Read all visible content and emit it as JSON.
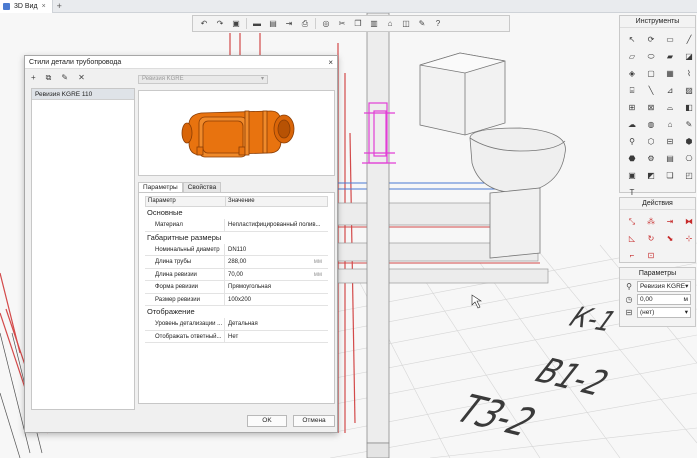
{
  "tab": {
    "title": "3D Вид",
    "close": "×",
    "add": "+"
  },
  "toolbar_icons": [
    "undo-icon",
    "redo-icon",
    "copy-view-icon",
    "save-icon",
    "save-as-icon",
    "export-icon",
    "print-icon",
    "render-icon",
    "cut-icon",
    "copy-icon",
    "paste-icon",
    "tag-icon",
    "layers-icon",
    "wrench-icon",
    "help-icon"
  ],
  "tools_panel": {
    "title": "Инструменты",
    "icons": [
      "pointer-icon",
      "rotate-icon",
      "rect-icon",
      "pipe-icon",
      "wall-icon",
      "slab-icon",
      "beam-icon",
      "column-icon",
      "part-icon",
      "fitting-icon",
      "duct-icon",
      "valve-icon",
      "stair-icon",
      "line-icon",
      "dim-icon",
      "hatch-icon",
      "text2-icon",
      "mep-icon",
      "fixture-icon",
      "equip-icon",
      "cloud-icon",
      "ring-icon",
      "house-icon",
      "pen-icon",
      "pin-icon",
      "shape-icon",
      "grid-icon",
      "cube-icon",
      "nut-icon",
      "gear-icon",
      "sheet-icon",
      "hex-icon",
      "box-icon",
      "wrap-icon",
      "copy2-icon",
      "layers2-icon",
      "text-icon"
    ]
  },
  "actions_panel": {
    "title": "Действия",
    "icons": [
      "move-icon",
      "array-icon",
      "align-icon",
      "mirror-icon",
      "offset-icon",
      "rotate2-icon",
      "stretch-icon",
      "split-icon",
      "trim-icon",
      "insert-icon"
    ]
  },
  "params_panel": {
    "title": "Параметры",
    "style_value": "Ревизия KGRE",
    "elevation_value": "0,00",
    "elevation_unit": "м",
    "level_value": "(нет)"
  },
  "dialog": {
    "title": "Стили детали трубопровода",
    "close": "×",
    "tool_glyphs": [
      "+",
      "⧉",
      "✎",
      "✕"
    ],
    "list_items": [
      "Ревизия KGRE 110"
    ],
    "preset_value": "Ревизия KGRE",
    "tabs": [
      "Параметры",
      "Свойства"
    ],
    "table_header": {
      "param": "Параметр",
      "value": "Значение"
    },
    "groups": [
      {
        "name": "Основные",
        "rows": [
          {
            "key": "Материал",
            "value": "Непластифицированный полив...",
            "unit": ""
          }
        ]
      },
      {
        "name": "Габаритные размеры",
        "rows": [
          {
            "key": "Номинальный диаметр",
            "value": "DN110",
            "unit": ""
          },
          {
            "key": "Длина трубы",
            "value": "288,00",
            "unit": "мм"
          },
          {
            "key": "Длина ревизии",
            "value": "70,00",
            "unit": "мм"
          },
          {
            "key": "Форма ревизии",
            "value": "Прямоугольная",
            "unit": ""
          },
          {
            "key": "Размер ревизии",
            "value": "100x200",
            "unit": ""
          }
        ]
      },
      {
        "name": "Отображение",
        "rows": [
          {
            "key": "Уровень детализации ...",
            "value": "Детальная",
            "unit": ""
          },
          {
            "key": "Отображать ответный...",
            "value": "Нет",
            "unit": ""
          }
        ]
      }
    ],
    "ok_label": "OK",
    "cancel_label": "Отмена"
  },
  "floor_labels": [
    "К-1",
    "В1-2",
    "Т3-2"
  ],
  "colors": {
    "accent": "#e8730f",
    "selection": "#e23fd6",
    "pipe_red": "#d34a4a",
    "pipe_blue": "#4a7ad3"
  }
}
